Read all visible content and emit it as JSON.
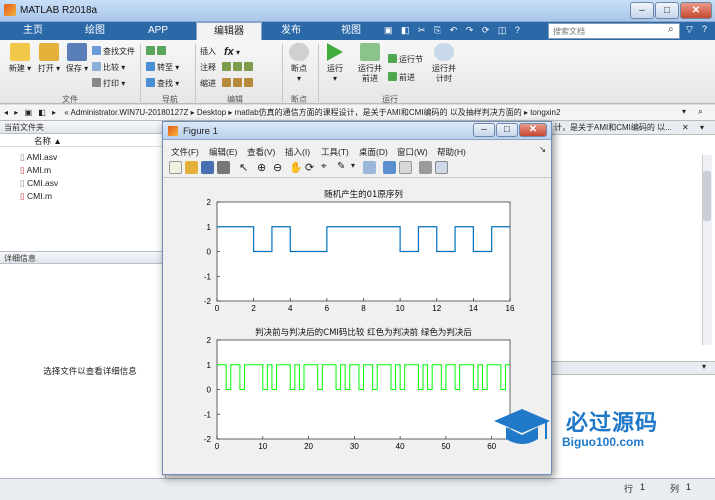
{
  "app": {
    "title": "MATLAB R2018a"
  },
  "window": {
    "min": "–",
    "max": "□",
    "close": "✕"
  },
  "tabs": [
    {
      "label": "主页"
    },
    {
      "label": "绘图"
    },
    {
      "label": "APP"
    },
    {
      "label": "编辑器"
    },
    {
      "label": "发布"
    },
    {
      "label": "视图"
    }
  ],
  "search": {
    "placeholder": "搜索文档"
  },
  "ribbon": {
    "file": {
      "new": "新建",
      "open": "打开",
      "save": "保存",
      "find_files": "查找文件",
      "compare": "比较",
      "print": "打印",
      "group": "文件"
    },
    "nav": {
      "goto": "转至",
      "find": "查找",
      "group": "导航"
    },
    "edit": {
      "insert": "插入",
      "comment": "注释",
      "indent": "缩进",
      "fx": "fx",
      "group": "编辑"
    },
    "breakpoints": {
      "label": "断点",
      "group": "断点"
    },
    "run": {
      "run": "运行",
      "run_advance": "运行并\n前进",
      "run_section": "运行节",
      "advance": "前进",
      "run_time": "运行并\n计时",
      "group": "运行"
    }
  },
  "address": {
    "path": "« Administrator.WIN7U-20180127Z  ▸  Desktop  ▸  matlab仿真的通信方面的课程设计，是关于AMI和CMI编码的 以及抽样判决方面的  ▸  tongxin2"
  },
  "left": {
    "current_folder": "当前文件夹",
    "name_col": "名称 ▲",
    "files": [
      {
        "name": "AMI.asv"
      },
      {
        "name": "AMI.m"
      },
      {
        "name": "CMI.asv"
      },
      {
        "name": "CMI.m"
      }
    ],
    "details": "详细信息",
    "details_hint": "选择文件以查看详细信息"
  },
  "editor": {
    "tab_text": "计，是关于AMI和CMI编码的 以..."
  },
  "figure": {
    "title": "Figure 1",
    "menu": [
      "文件(F)",
      "编辑(E)",
      "查看(V)",
      "插入(I)",
      "工具(T)",
      "桌面(D)",
      "窗口(W)",
      "帮助(H)"
    ]
  },
  "status": {
    "row_label": "行",
    "row": "1",
    "col_label": "列",
    "col": "1"
  },
  "watermark": {
    "cn": "必过源码",
    "en": "Biguo100.com"
  },
  "chart_data": [
    {
      "type": "line",
      "title": "随机产生的01原序列",
      "xlim": [
        0,
        16
      ],
      "ylim": [
        -2,
        2
      ],
      "xticks": [
        0,
        2,
        4,
        6,
        8,
        10,
        12,
        14,
        16
      ],
      "yticks": [
        -2,
        -1,
        0,
        1,
        2
      ],
      "bits": [
        1,
        1,
        0,
        1,
        0,
        0,
        1,
        1,
        1,
        1,
        0,
        1,
        0,
        1,
        0,
        1
      ],
      "color": "#0072bd"
    },
    {
      "type": "line",
      "title": "判决前与判决后的CMI码比较 红色为判决前 绿色为判决后",
      "xlim": [
        0,
        64
      ],
      "ylim": [
        -2,
        2
      ],
      "xticks": [
        0,
        10,
        20,
        30,
        40,
        50,
        60
      ],
      "yticks": [
        -2,
        -1,
        0,
        1,
        2
      ],
      "levels": [
        1,
        1,
        0,
        1,
        1,
        0,
        1,
        1,
        1,
        1,
        0,
        1,
        0,
        1,
        1,
        1,
        0,
        1,
        0,
        1,
        1,
        1,
        0,
        1,
        1,
        1,
        0,
        1,
        0,
        1,
        1,
        0,
        1,
        1,
        0,
        1,
        1,
        1,
        0,
        1,
        0,
        1,
        1,
        1,
        0,
        1,
        0,
        1,
        1,
        0,
        1,
        1,
        0,
        1,
        1,
        1,
        0,
        1,
        0,
        1,
        1,
        1,
        0,
        1
      ],
      "color": "#00ff00"
    }
  ]
}
